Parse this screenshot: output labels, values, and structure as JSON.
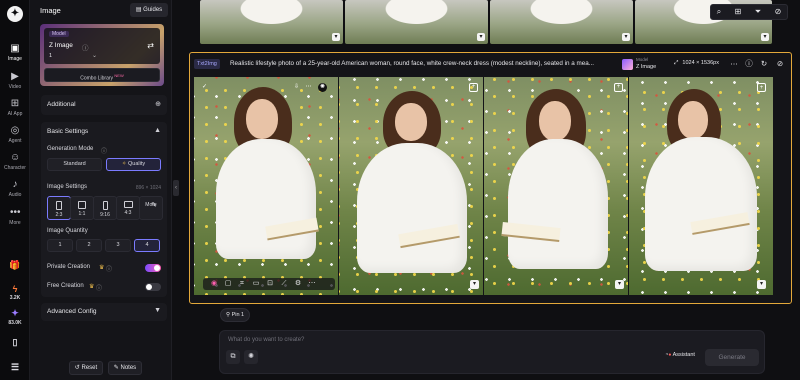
{
  "rail": {
    "items": [
      {
        "label": "Image",
        "icon": "image-icon"
      },
      {
        "label": "Video",
        "icon": "video-icon"
      },
      {
        "label": "AI App",
        "icon": "ai-app-icon"
      },
      {
        "label": "Agent",
        "icon": "agent-icon"
      },
      {
        "label": "Character",
        "icon": "character-icon"
      },
      {
        "label": "Audio",
        "icon": "audio-icon"
      },
      {
        "label": "More",
        "icon": "more-icon"
      }
    ],
    "credits": [
      {
        "value": "3.2K",
        "icon": "bolt-icon"
      },
      {
        "value": "83.0K",
        "icon": "gem-icon"
      }
    ]
  },
  "panel": {
    "title": "Image",
    "guides_label": "Guides",
    "model": {
      "tag": "Model",
      "name": "Z Image",
      "count": "1",
      "combo_label": "Combo Library",
      "combo_badge": "NEW"
    },
    "additional_label": "Additional",
    "basic_settings": {
      "title": "Basic Settings",
      "generation_mode": {
        "label": "Generation Mode",
        "options": [
          "Standard",
          "Quality"
        ],
        "selected": "Quality"
      },
      "image_settings": {
        "label": "Image Settings",
        "size_hint": "896 × 1024",
        "ratios": [
          "2:3",
          "1:1",
          "9:16",
          "4:3",
          "More"
        ],
        "selected": "2:3"
      },
      "image_quantity": {
        "label": "Image Quantity",
        "options": [
          "1",
          "2",
          "3",
          "4"
        ],
        "selected": "4"
      },
      "private_creation": {
        "label": "Private Creation",
        "on": true
      },
      "free_creation": {
        "label": "Free Creation",
        "on": false
      }
    },
    "advanced_label": "Advanced Config",
    "reset_label": "Reset",
    "notes_label": "Notes"
  },
  "generation": {
    "type_badge": "Txt2Img",
    "prompt": "Realistic lifestyle photo of a 25-year-old American woman, round face, white crew-neck dress (modest neckline), seated in a mea...",
    "model_key": "Model",
    "model_value": "Z Image",
    "resolution": "1024 × 1536px"
  },
  "pin_chip": "Pin 1",
  "composer": {
    "placeholder": "What do you want to create?",
    "assistant_label": "Assistant",
    "generate_label": "Generate"
  },
  "colors": {
    "accent": "#7b7bff",
    "selection_border": "#e3a83a",
    "toggle_on": "#ff5fb0"
  }
}
